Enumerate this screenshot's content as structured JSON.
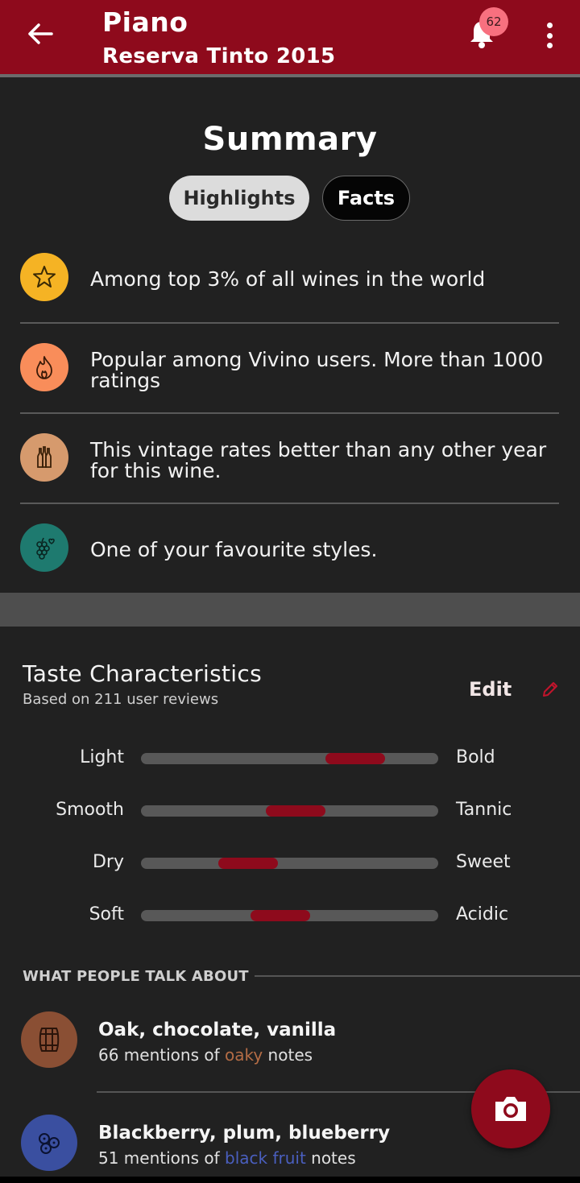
{
  "header": {
    "title": "Piano",
    "subtitle": "Reserva Tinto 2015",
    "notification_count": "62",
    "icons": {
      "back": "arrow-left-icon",
      "bell": "bell-icon",
      "more": "more-vert-icon"
    }
  },
  "summary": {
    "title": "Summary",
    "tabs": [
      {
        "label": "Highlights",
        "selected": true
      },
      {
        "label": "Facts",
        "selected": false
      }
    ],
    "highlights": [
      {
        "icon": "star-icon",
        "color": "#f5b324",
        "text": "Among top 3% of all wines in the world"
      },
      {
        "icon": "flame-icon",
        "color": "#f98d5a",
        "text": "Popular among Vivino users. More than 1000 ratings"
      },
      {
        "icon": "bottles-icon",
        "color": "#d69a6d",
        "text": "This vintage rates better than any other year for this wine."
      },
      {
        "icon": "grapes-heart-icon",
        "color": "#1e7a6f",
        "text": "One of your favourite styles."
      }
    ]
  },
  "taste": {
    "title": "Taste Characteristics",
    "subtitle": "Based on 211 user reviews",
    "edit_label": "Edit",
    "scales": [
      {
        "left": "Light",
        "right": "Bold",
        "value": 0.72
      },
      {
        "left": "Smooth",
        "right": "Tannic",
        "value": 0.52
      },
      {
        "left": "Dry",
        "right": "Sweet",
        "value": 0.36
      },
      {
        "left": "Soft",
        "right": "Acidic",
        "value": 0.47
      }
    ],
    "talk_heading": "WHAT PEOPLE TALK ABOUT",
    "mentions": [
      {
        "icon": "barrel-icon",
        "color": "#8a4f34",
        "name": "Oak, chocolate, vanilla",
        "count_prefix": "66 mentions of ",
        "keyword": "oaky",
        "keyword_color": "#b46c45",
        "count_suffix": " notes"
      },
      {
        "icon": "berries-icon",
        "color": "#3a4fa0",
        "name": "Blackberry, plum, blueberry",
        "count_prefix": "51 mentions of ",
        "keyword": "black fruit",
        "keyword_color": "#4a5fbf",
        "count_suffix": " notes"
      }
    ]
  },
  "fab": {
    "icon": "camera-icon"
  },
  "colors": {
    "brand": "#8e0a1c",
    "background": "#212121"
  }
}
